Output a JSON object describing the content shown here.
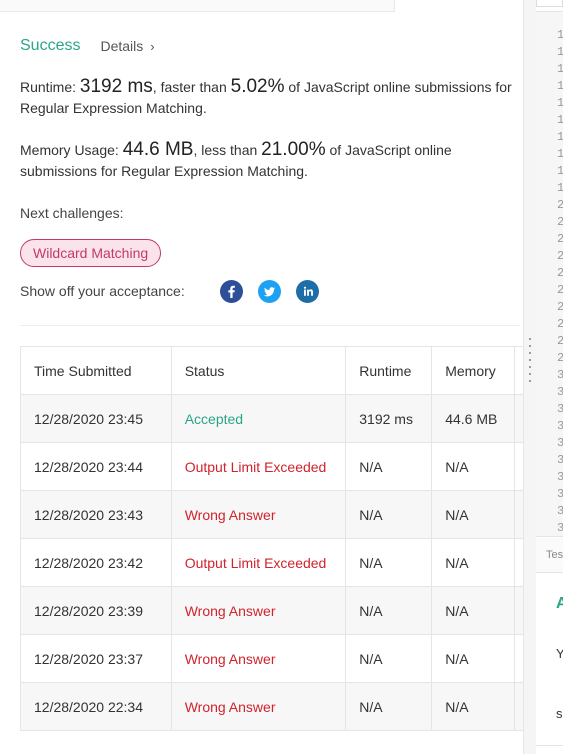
{
  "result": {
    "status": "Success",
    "details_label": "Details",
    "details_chevron": "›"
  },
  "runtime": {
    "prefix": "Runtime: ",
    "value": "3192 ms",
    "mid": ", faster than ",
    "percent": "5.02%",
    "suffix": " of JavaScript online submissions for Regular Expression Matching."
  },
  "memory": {
    "prefix": "Memory Usage: ",
    "value": "44.6 MB",
    "mid": ", less than ",
    "percent": "21.00%",
    "suffix": " of JavaScript online submissions for Regular Expression Matching."
  },
  "next": {
    "label": "Next challenges:",
    "challenge": "Wildcard Matching"
  },
  "share": {
    "label": "Show off your acceptance:",
    "icons": [
      "facebook-icon",
      "twitter-icon",
      "linkedin-icon"
    ]
  },
  "table": {
    "headers": [
      "Time Submitted",
      "Status",
      "Runtime",
      "Memory",
      ""
    ],
    "rows": [
      {
        "time": "12/28/2020 23:45",
        "status": "Accepted",
        "runtime": "3192 ms",
        "memory": "44.6 MB",
        "ok": true
      },
      {
        "time": "12/28/2020 23:44",
        "status": "Output Limit Exceeded",
        "runtime": "N/A",
        "memory": "N/A",
        "ok": false
      },
      {
        "time": "12/28/2020 23:43",
        "status": "Wrong Answer",
        "runtime": "N/A",
        "memory": "N/A",
        "ok": false
      },
      {
        "time": "12/28/2020 23:42",
        "status": "Output Limit Exceeded",
        "runtime": "N/A",
        "memory": "N/A",
        "ok": false
      },
      {
        "time": "12/28/2020 23:39",
        "status": "Wrong Answer",
        "runtime": "N/A",
        "memory": "N/A",
        "ok": false
      },
      {
        "time": "12/28/2020 23:37",
        "status": "Wrong Answer",
        "runtime": "N/A",
        "memory": "N/A",
        "ok": false
      },
      {
        "time": "12/28/2020 22:34",
        "status": "Wrong Answer",
        "runtime": "N/A",
        "memory": "N/A",
        "ok": false
      }
    ]
  },
  "editor": {
    "line_numbers": [
      "1",
      "1",
      "1",
      "1",
      "1",
      "1",
      "1",
      "1",
      "1",
      "1",
      "2",
      "2",
      "2",
      "2",
      "2",
      "2",
      "2",
      "2",
      "2",
      "2",
      "3",
      "3",
      "3",
      "3",
      "3",
      "3",
      "3",
      "3",
      "3",
      "3"
    ],
    "console_tab": "Tes",
    "console_status": "A",
    "console_line2": "Y",
    "console_line3": "s"
  },
  "colors": {
    "success": "#2ba58a",
    "error": "#d0232d",
    "challenge_text": "#c33a67",
    "challenge_bg": "#fbe3ec"
  }
}
